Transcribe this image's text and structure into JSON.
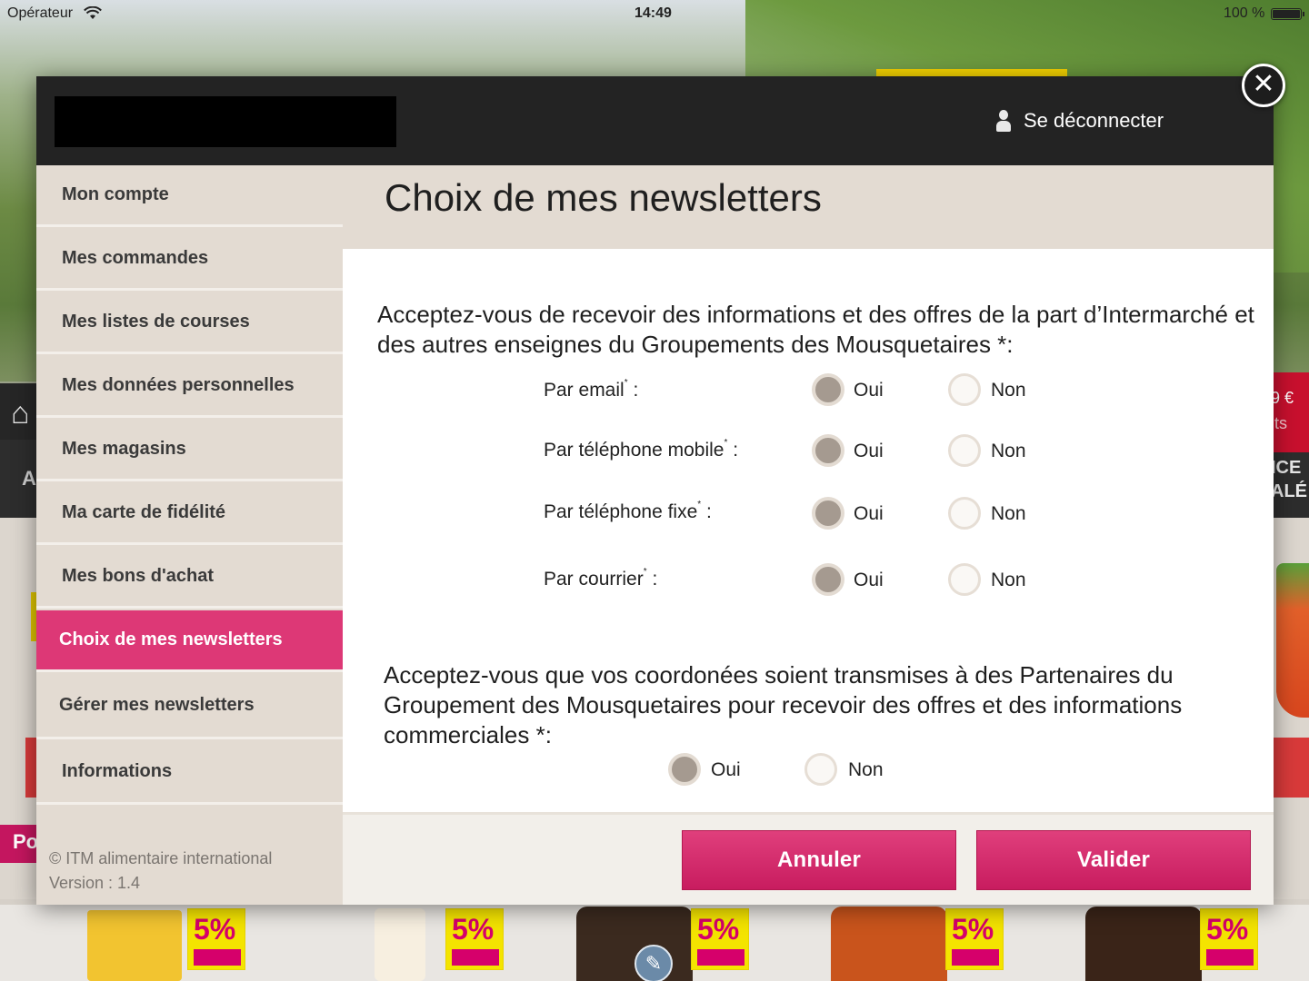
{
  "status_bar": {
    "carrier": "Opérateur",
    "time": "14:49",
    "battery": "100 %"
  },
  "background": {
    "right_price": "9 €",
    "right_sub": "its",
    "right_text_1": "ICE",
    "right_text_2": "ALÉ",
    "left_letter": "A",
    "left_pink": "Po",
    "product_badge": "5%"
  },
  "header": {
    "logout_label": "Se déconnecter"
  },
  "sidebar": {
    "items": [
      {
        "label": "Mon compte"
      },
      {
        "label": "Mes commandes"
      },
      {
        "label": "Mes listes de courses"
      },
      {
        "label": "Mes données personnelles"
      },
      {
        "label": "Mes magasins"
      },
      {
        "label": "Ma carte de fidélité"
      },
      {
        "label": "Mes bons d'achat"
      },
      {
        "label": "Choix de mes newsletters",
        "active": true
      },
      {
        "label": "Gérer mes newsletters"
      },
      {
        "label": "Informations"
      }
    ],
    "copyright": "© ITM alimentaire international",
    "version": "Version : 1.4"
  },
  "main": {
    "title": "Choix de mes newsletters",
    "question1": "Acceptez-vous de recevoir des informations et des offres de la part d’Intermarché et des autres enseignes du Groupements des Mousquetaires *:",
    "rows": [
      {
        "label": "Par email",
        "suffix": " :",
        "selected": "Oui"
      },
      {
        "label": "Par téléphone mobile",
        "suffix": " :",
        "selected": "Oui"
      },
      {
        "label": "Par téléphone fixe",
        "suffix": " :",
        "selected": "Oui"
      },
      {
        "label": "Par courrier",
        "suffix": " :",
        "selected": "Oui"
      }
    ],
    "option_yes": "Oui",
    "option_no": "Non",
    "required_mark": "*",
    "question2": "Acceptez-vous que vos coordonées soient transmises à des Partenaires du Groupement des Mousquetaires pour recevoir des offres et des informations commerciales *:",
    "question2_selected": "Oui"
  },
  "footer": {
    "cancel_label": "Annuler",
    "submit_label": "Valider"
  },
  "colors": {
    "accent": "#dd3876",
    "header_bg": "#232323",
    "sidebar_bg": "#e3dbd2",
    "radio_checked": "#a59a90"
  },
  "icons": [
    "wifi-icon",
    "battery-icon",
    "user-icon",
    "close-icon",
    "home-icon",
    "wrench-icon"
  ]
}
